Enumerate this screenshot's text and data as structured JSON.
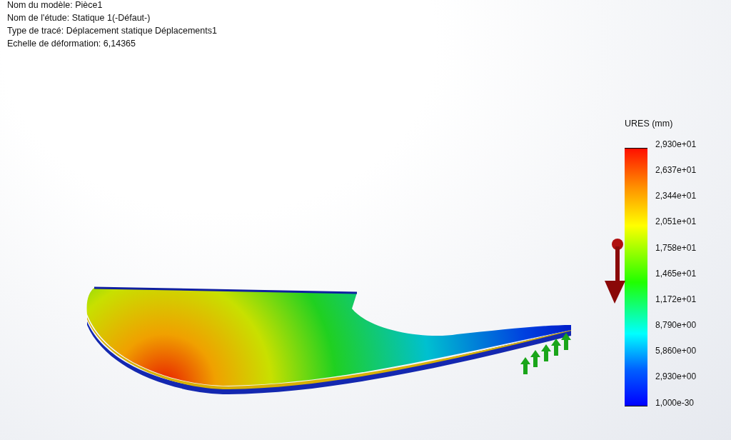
{
  "plot_info": [
    "Nom du modèle: Pièce1",
    "Nom de l'étude: Statique 1(-Défaut-)",
    "Type de tracé: Déplacement statique Déplacements1",
    "Echelle de déformation: 6,14365"
  ],
  "legend": {
    "title": "URES (mm)",
    "labels": [
      "2,930e+01",
      "2,637e+01",
      "2,344e+01",
      "2,051e+01",
      "1,758e+01",
      "1,465e+01",
      "1,172e+01",
      "8,790e+00",
      "5,860e+00",
      "2,930e+00",
      "1,000e-30"
    ]
  }
}
